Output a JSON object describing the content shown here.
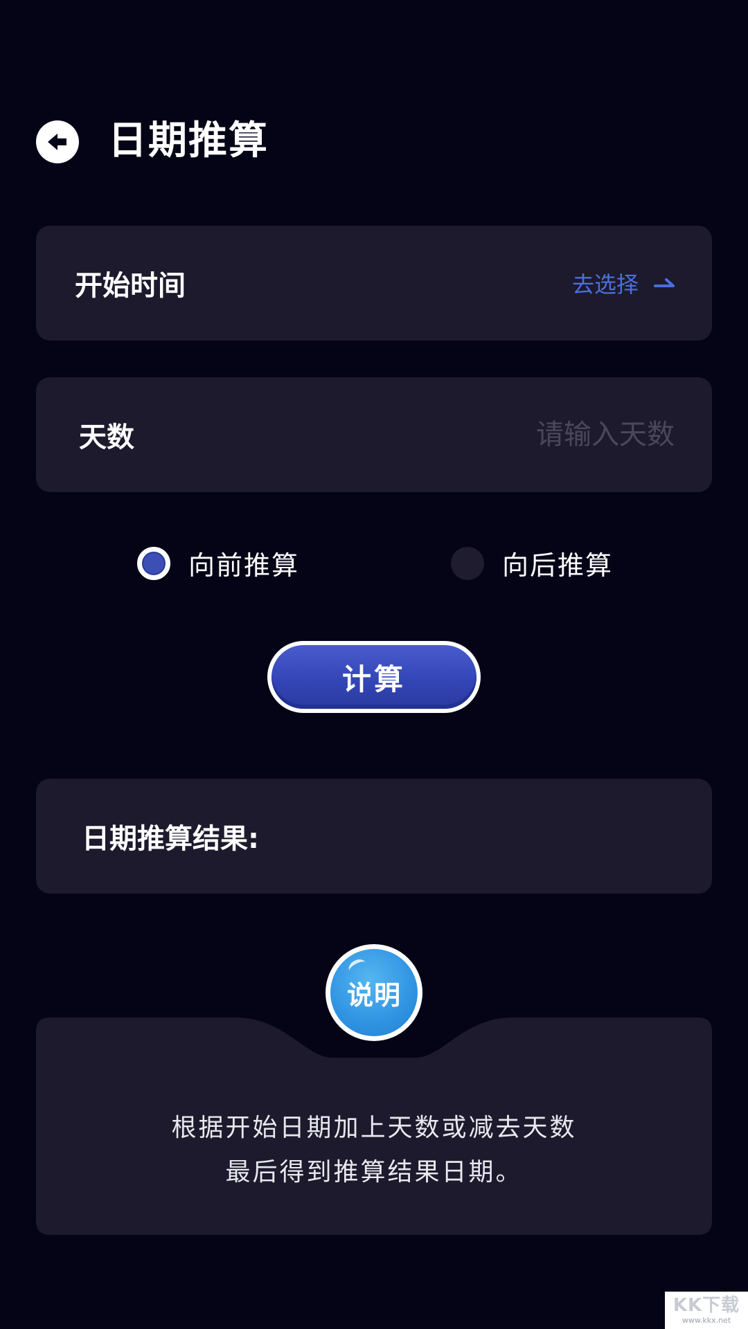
{
  "header": {
    "title": "日期推算",
    "back_icon": "arrow-left-circle-icon"
  },
  "start_time": {
    "label": "开始时间",
    "action_label": "去选择",
    "action_icon": "arrow-right-icon"
  },
  "days": {
    "label": "天数",
    "placeholder": "请输入天数",
    "value": ""
  },
  "direction": {
    "options": [
      {
        "label": "向前推算",
        "checked": true
      },
      {
        "label": "向后推算",
        "checked": false
      }
    ]
  },
  "calculate": {
    "label": "计算"
  },
  "result": {
    "label": "日期推算结果:",
    "value": ""
  },
  "explanation": {
    "badge_label": "说明",
    "lines": [
      "根据开始日期加上天数或减去天数",
      "最后得到推算结果日期。"
    ]
  },
  "watermark": {
    "logo": "KK下载",
    "url": "www.kkx.net"
  },
  "colors": {
    "background": "#050316",
    "card": "#1c1a2c",
    "accent": "#4b6fe0",
    "button": "#3346b6",
    "badge": "#2f93e2"
  }
}
